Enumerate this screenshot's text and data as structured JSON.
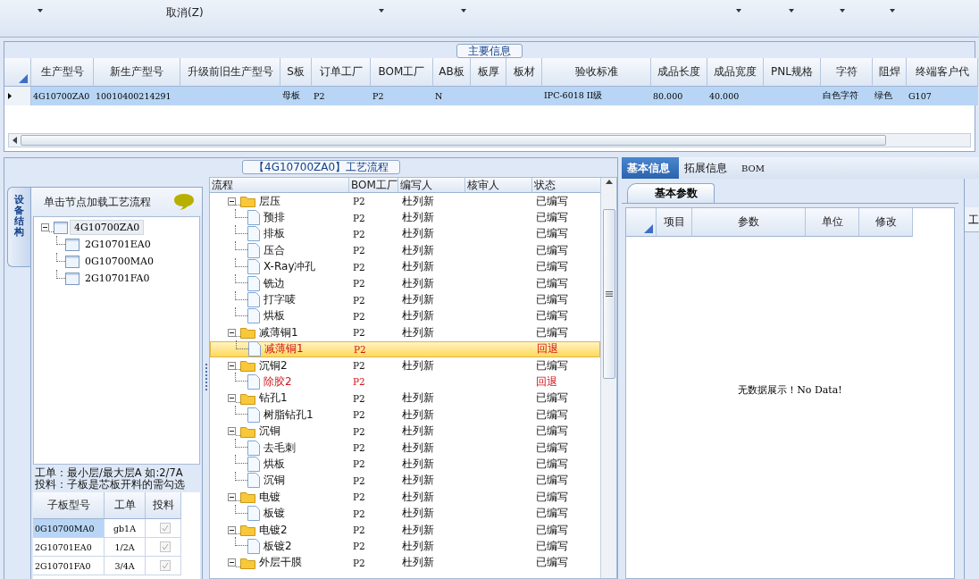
{
  "menu": {
    "items": [
      "取消(Z)"
    ]
  },
  "main_info": {
    "title": "主要信息",
    "columns": [
      "生产型号",
      "新生产型号",
      "升级前旧生产型号",
      "S板",
      "订单工厂",
      "BOM工厂",
      "AB板",
      "板厚",
      "板材",
      "验收标准",
      "成品长度",
      "成品宽度",
      "PNL规格",
      "字符",
      "阻焊",
      "终端客户代"
    ],
    "rows": [
      {
        "selected": true,
        "cells": [
          "4G10700ZA0",
          "10010400214291",
          "",
          "母板",
          "P2",
          "P2",
          "N",
          "",
          "",
          "IPC-6018 II级",
          "80.000",
          "40.000",
          "",
          "白色字符",
          "绿色",
          "G107"
        ]
      }
    ]
  },
  "process_panel": {
    "title": "【4G10700ZA0】工艺流程"
  },
  "side_tab": {
    "label": "设备结构"
  },
  "structure": {
    "hint": "单击节点加载工艺流程",
    "tree": [
      {
        "label": "4G10700ZA0",
        "expanded": true,
        "selected": true,
        "children": [
          {
            "label": "2G10701EA0",
            "selected": false
          },
          {
            "label": "0G10700MA0",
            "selected": false
          },
          {
            "label": "2G10701FA0",
            "selected": false
          }
        ]
      }
    ],
    "notes": [
      "工单：最小层/最大层A 如:2/7A",
      "投料：子板是芯板开料的需勾选"
    ],
    "columns": [
      "子板型号",
      "工单",
      "投料"
    ],
    "rows": [
      {
        "board": "0G10700MA0",
        "order": "gb1A",
        "feed": true,
        "selected": true
      },
      {
        "board": "2G10701EA0",
        "order": "1/2A",
        "feed": true,
        "selected": false
      },
      {
        "board": "2G10701FA0",
        "order": "3/4A",
        "feed": true,
        "selected": false
      }
    ]
  },
  "process": {
    "columns": [
      "流程",
      "BOM工厂",
      "编写人",
      "核审人",
      "状态"
    ],
    "rows": [
      {
        "name": "层压",
        "factory": "P2",
        "writer": "杜列新",
        "status": "已编写",
        "returned": false,
        "selected": false,
        "expanded": true,
        "children": [
          {
            "name": "预排",
            "factory": "P2",
            "writer": "杜列新",
            "status": "已编写",
            "returned": false,
            "selected": false
          },
          {
            "name": "排板",
            "factory": "P2",
            "writer": "杜列新",
            "status": "已编写",
            "returned": false,
            "selected": false
          },
          {
            "name": "压合",
            "factory": "P2",
            "writer": "杜列新",
            "status": "已编写",
            "returned": false,
            "selected": false
          },
          {
            "name": "X-Ray冲孔",
            "factory": "P2",
            "writer": "杜列新",
            "status": "已编写",
            "returned": false,
            "selected": false
          },
          {
            "name": "铣边",
            "factory": "P2",
            "writer": "杜列新",
            "status": "已编写",
            "returned": false,
            "selected": false
          },
          {
            "name": "打字唛",
            "factory": "P2",
            "writer": "杜列新",
            "status": "已编写",
            "returned": false,
            "selected": false
          },
          {
            "name": "烘板",
            "factory": "P2",
            "writer": "杜列新",
            "status": "已编写",
            "returned": false,
            "selected": false
          }
        ]
      },
      {
        "name": "减薄铜1",
        "factory": "P2",
        "writer": "杜列新",
        "status": "已编写",
        "returned": false,
        "selected": false,
        "expanded": true,
        "children": [
          {
            "name": "减薄铜1",
            "factory": "P2",
            "status": "回退",
            "returned": true,
            "selected": true
          }
        ]
      },
      {
        "name": "沉铜2",
        "factory": "P2",
        "writer": "杜列新",
        "status": "已编写",
        "returned": false,
        "selected": false,
        "expanded": true,
        "children": [
          {
            "name": "除胶2",
            "factory": "P2",
            "status": "回退",
            "returned": true,
            "selected": false
          }
        ]
      },
      {
        "name": "钻孔1",
        "factory": "P2",
        "writer": "杜列新",
        "status": "已编写",
        "returned": false,
        "selected": false,
        "expanded": true,
        "children": [
          {
            "name": "树脂钻孔1",
            "factory": "P2",
            "writer": "杜列新",
            "status": "已编写",
            "returned": false,
            "selected": false
          }
        ]
      },
      {
        "name": "沉铜",
        "factory": "P2",
        "writer": "杜列新",
        "status": "已编写",
        "returned": false,
        "selected": false,
        "expanded": true,
        "children": [
          {
            "name": "去毛刺",
            "factory": "P2",
            "writer": "杜列新",
            "status": "已编写",
            "returned": false,
            "selected": false
          },
          {
            "name": "烘板",
            "factory": "P2",
            "writer": "杜列新",
            "status": "已编写",
            "returned": false,
            "selected": false
          },
          {
            "name": "沉铜",
            "factory": "P2",
            "writer": "杜列新",
            "status": "已编写",
            "returned": false,
            "selected": false
          }
        ]
      },
      {
        "name": "电镀",
        "factory": "P2",
        "writer": "杜列新",
        "status": "已编写",
        "returned": false,
        "selected": false,
        "expanded": true,
        "children": [
          {
            "name": "板镀",
            "factory": "P2",
            "writer": "杜列新",
            "status": "已编写",
            "returned": false,
            "selected": false
          }
        ]
      },
      {
        "name": "电镀2",
        "factory": "P2",
        "writer": "杜列新",
        "status": "已编写",
        "returned": false,
        "selected": false,
        "expanded": true,
        "children": [
          {
            "name": "板镀2",
            "factory": "P2",
            "writer": "杜列新",
            "status": "已编写",
            "returned": false,
            "selected": false
          }
        ]
      },
      {
        "name": "外层干膜",
        "factory": "P2",
        "writer": "杜列新",
        "status": "已编写",
        "returned": false,
        "selected": false,
        "expanded": true
      }
    ]
  },
  "detail": {
    "tabs": [
      {
        "label": "基本信息",
        "selected": true
      },
      {
        "label": "拓展信息",
        "selected": false
      },
      {
        "label": "BOM",
        "selected": false
      }
    ],
    "subtab": {
      "label": "基本参数",
      "selected": true
    },
    "columns": [
      "项目",
      "参数",
      "单位",
      "修改"
    ],
    "empty_message": "无数据展示！No Data!",
    "side_label": "工"
  }
}
